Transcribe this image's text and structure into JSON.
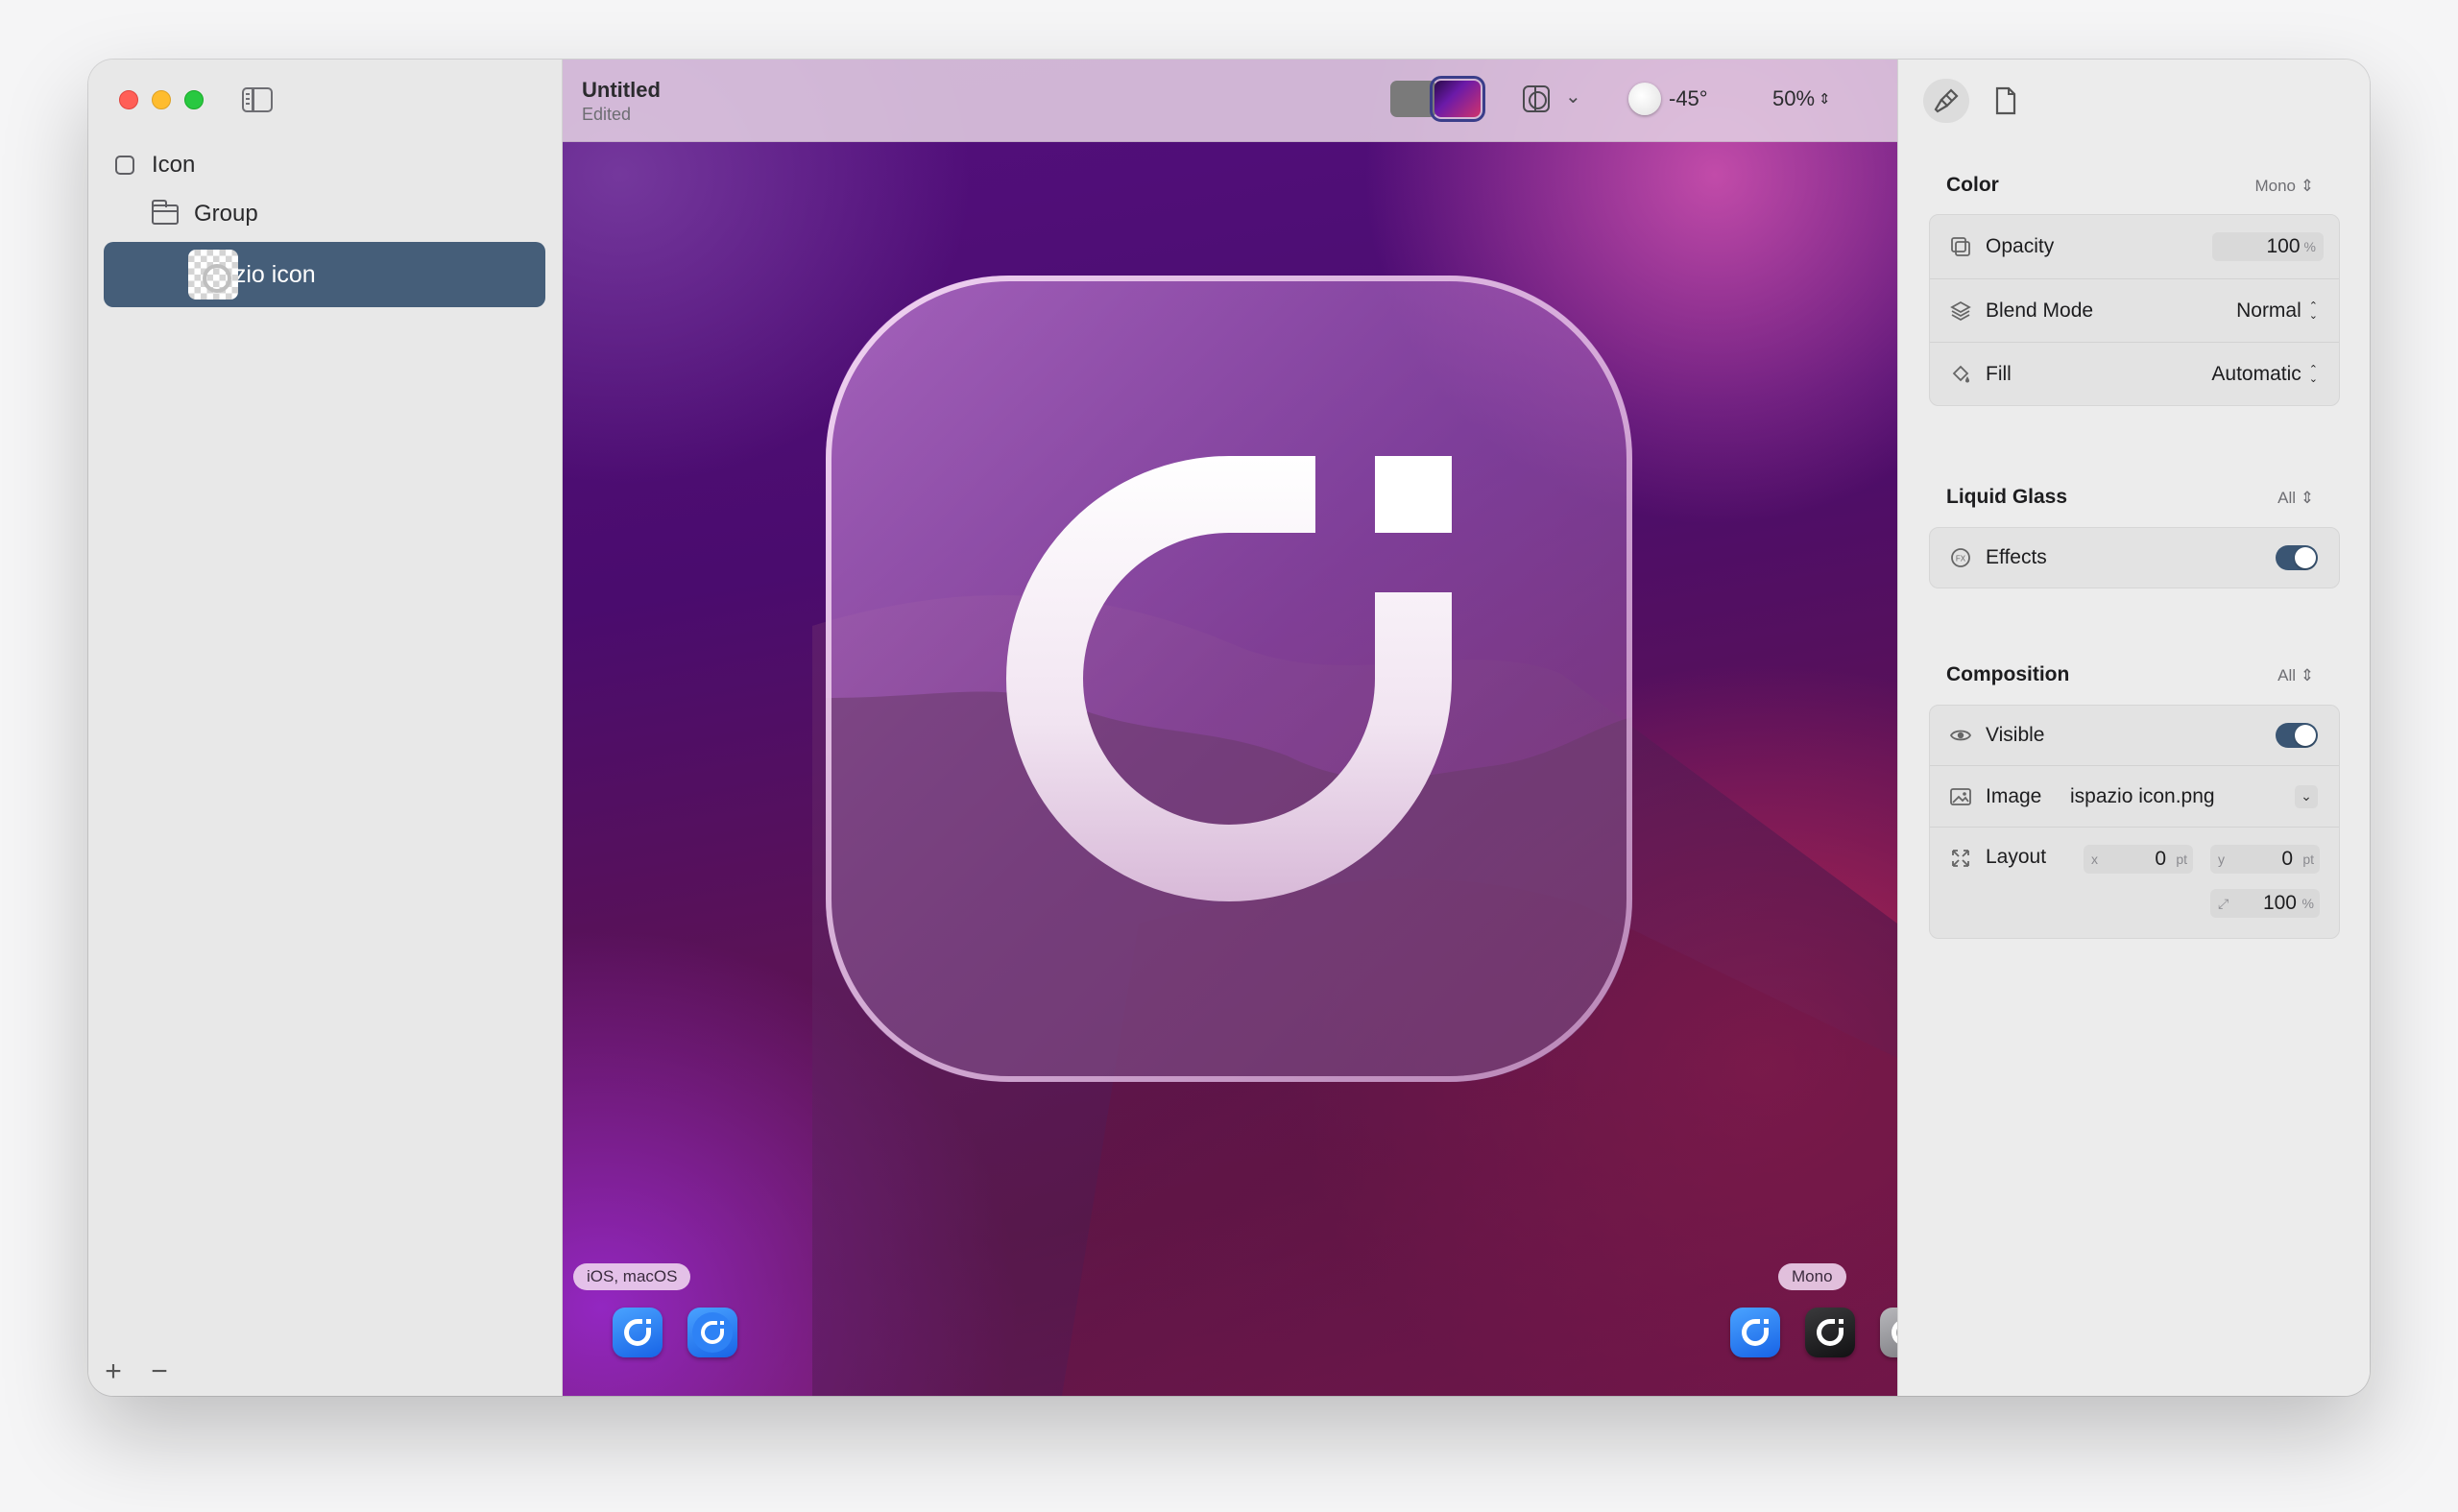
{
  "document": {
    "title": "Untitled",
    "subtitle": "Edited"
  },
  "sidebar": {
    "items": [
      {
        "label": "Icon"
      },
      {
        "label": "Group"
      },
      {
        "label": "ispazio icon"
      }
    ],
    "add_label": "+",
    "remove_label": "−"
  },
  "toolbar": {
    "light_angle": "-45°",
    "zoom": "50%",
    "selected_background": "purple-gradient"
  },
  "canvas": {
    "platform_badge": "iOS, macOS",
    "mono_badge": "Mono"
  },
  "inspector": {
    "color": {
      "title": "Color",
      "mode": "Mono",
      "opacity_label": "Opacity",
      "opacity_value": "100",
      "opacity_unit": "%",
      "blend_label": "Blend Mode",
      "blend_value": "Normal",
      "fill_label": "Fill",
      "fill_value": "Automatic"
    },
    "liquid_glass": {
      "title": "Liquid Glass",
      "mode": "All",
      "effects_label": "Effects",
      "effects_on": true
    },
    "composition": {
      "title": "Composition",
      "mode": "All",
      "visible_label": "Visible",
      "visible_on": true,
      "image_label": "Image",
      "image_value": "ispazio icon.png",
      "layout_label": "Layout",
      "x_axis": "x",
      "x_value": "0",
      "y_axis": "y",
      "y_value": "0",
      "pt_unit": "pt",
      "scale_value": "100",
      "scale_unit": "%"
    }
  },
  "colors": {
    "selection": "#455e79",
    "toggle_on": "#3a5573",
    "icon_blue": "#1f74f0"
  }
}
